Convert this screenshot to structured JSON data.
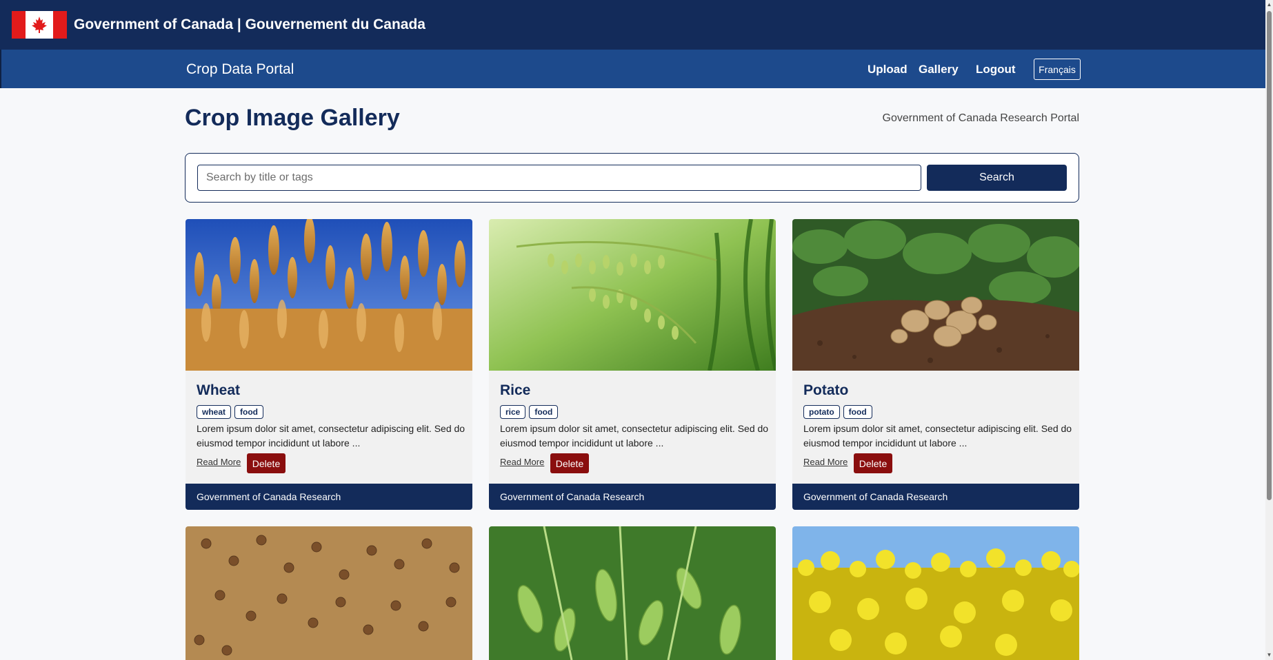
{
  "header": {
    "gov_title": "Government of Canada | Gouvernement du Canada"
  },
  "nav": {
    "portal_name": "Crop Data Portal",
    "links": [
      "Upload",
      "Gallery",
      "Logout"
    ],
    "language_button": "Français"
  },
  "main": {
    "title": "Crop Image Gallery",
    "subtitle": "Government of Canada Research Portal",
    "search": {
      "placeholder": "Search by title or tags",
      "button_label": "Search"
    }
  },
  "cards": [
    {
      "title": "Wheat",
      "tags": [
        "wheat",
        "food"
      ],
      "description": "Lorem ipsum dolor sit amet, consectetur adipiscing elit. Sed do eiusmod tempor incididunt ut labore ...",
      "read_more": "Read More",
      "delete_label": "Delete",
      "footer": "Government of Canada Research"
    },
    {
      "title": "Rice",
      "tags": [
        "rice",
        "food"
      ],
      "description": "Lorem ipsum dolor sit amet, consectetur adipiscing elit. Sed do eiusmod tempor incididunt ut labore ...",
      "read_more": "Read More",
      "delete_label": "Delete",
      "footer": "Government of Canada Research"
    },
    {
      "title": "Potato",
      "tags": [
        "potato",
        "food"
      ],
      "description": "Lorem ipsum dolor sit amet, consectetur adipiscing elit. Sed do eiusmod tempor incididunt ut labore ...",
      "read_more": "Read More",
      "delete_label": "Delete",
      "footer": "Government of Canada Research"
    }
  ],
  "colors": {
    "gov_bar": "#132b5a",
    "nav_bar": "#1d4a8c",
    "delete": "#8a0e0e",
    "flag_red": "#e21b1b"
  }
}
